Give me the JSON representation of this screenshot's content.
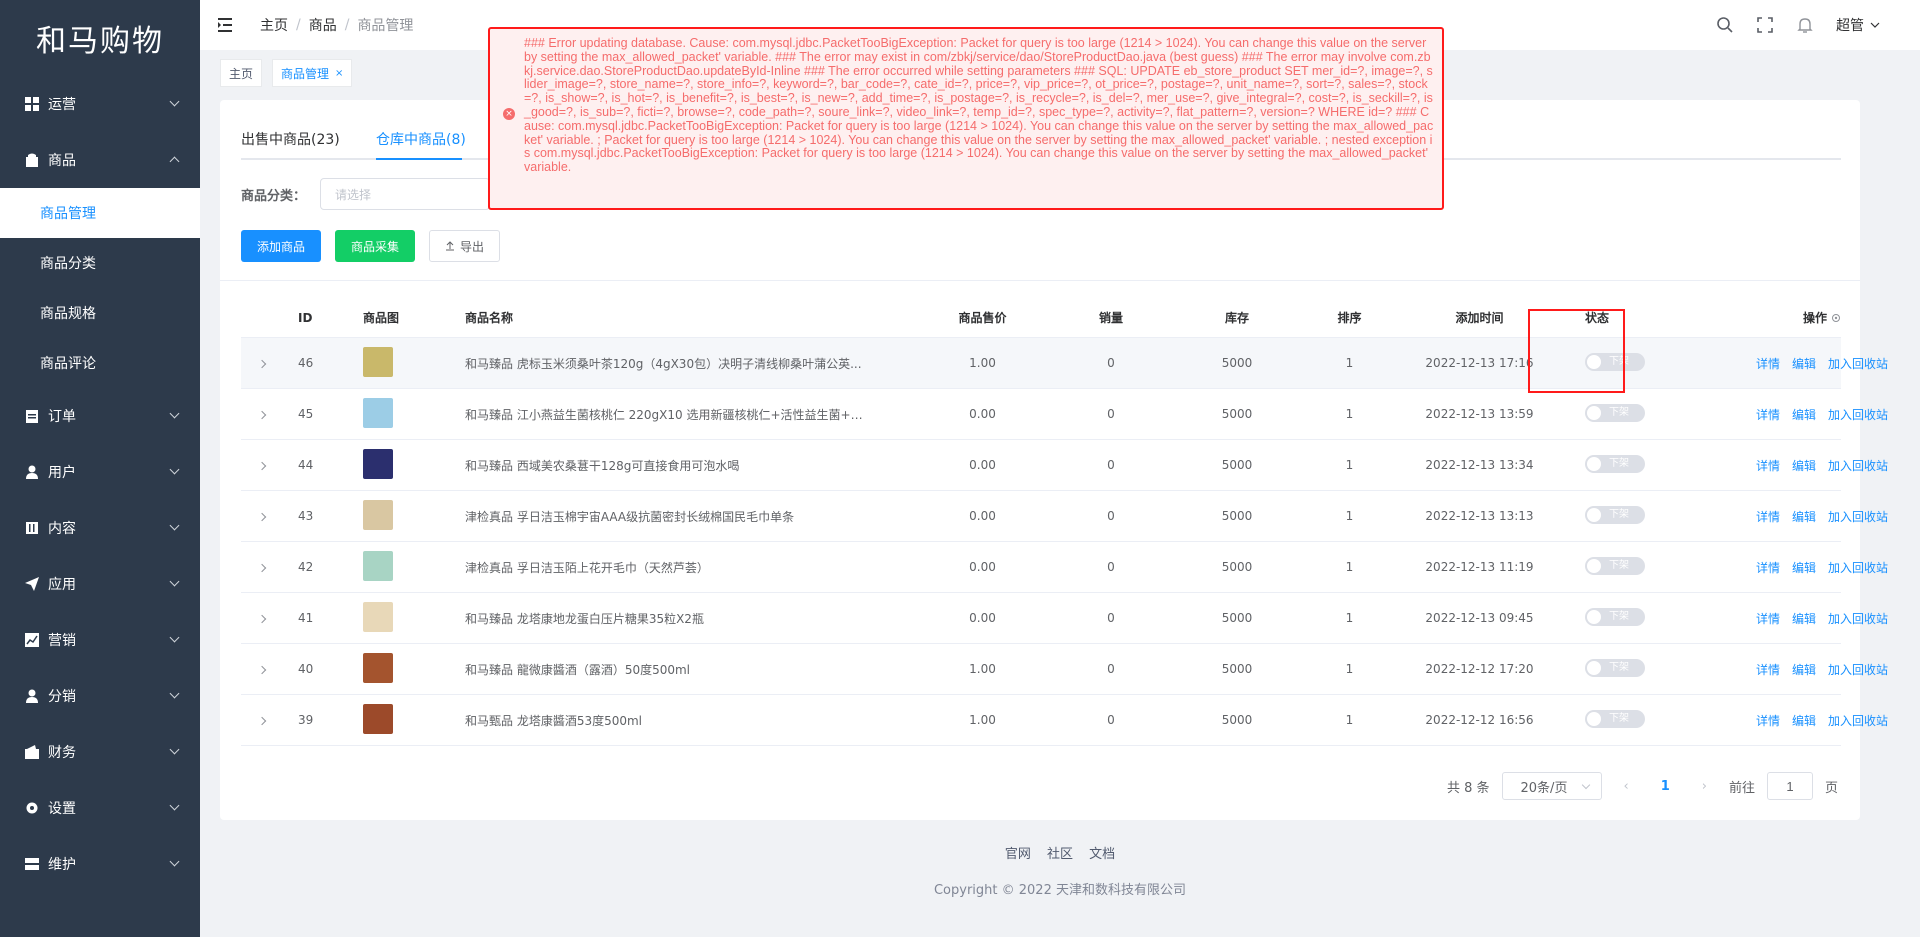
{
  "app": {
    "logo": "和马购物"
  },
  "sidebar": {
    "items": [
      {
        "label": "运营",
        "icon": "grid-icon",
        "expanded": false
      },
      {
        "label": "商品",
        "icon": "bag-icon",
        "expanded": true,
        "children": [
          "商品管理",
          "商品分类",
          "商品规格",
          "商品评论"
        ]
      },
      {
        "label": "订单",
        "icon": "clipboard-icon",
        "expanded": false
      },
      {
        "label": "用户",
        "icon": "user-icon",
        "expanded": false
      },
      {
        "label": "内容",
        "icon": "book-icon",
        "expanded": false
      },
      {
        "label": "应用",
        "icon": "send-icon",
        "expanded": false
      },
      {
        "label": "营销",
        "icon": "chart-icon",
        "expanded": false
      },
      {
        "label": "分销",
        "icon": "user-icon",
        "expanded": false
      },
      {
        "label": "财务",
        "icon": "wallet-icon",
        "expanded": false
      },
      {
        "label": "设置",
        "icon": "gear-icon",
        "expanded": false
      },
      {
        "label": "维护",
        "icon": "server-icon",
        "expanded": false
      }
    ],
    "active_child": "商品管理"
  },
  "header": {
    "breadcrumb": [
      "主页",
      "商品",
      "商品管理"
    ],
    "user": "超管"
  },
  "tags": [
    {
      "label": "主页",
      "active": false
    },
    {
      "label": "商品管理",
      "active": true,
      "close": "×"
    }
  ],
  "tabs": [
    {
      "label": "出售中商品(23)",
      "active": false
    },
    {
      "label": "仓库中商品(8)",
      "active": true
    }
  ],
  "filter": {
    "label": "商品分类：",
    "placeholder": "请选择"
  },
  "buttons": {
    "add": "添加商品",
    "collect": "商品采集",
    "export": "导出"
  },
  "table": {
    "columns": [
      "ID",
      "商品图",
      "商品名称",
      "商品售价",
      "销量",
      "库存",
      "排序",
      "添加时间",
      "状态",
      "操作"
    ],
    "rows": [
      {
        "id": "46",
        "name": "和马臻品 虎标玉米须桑叶茶120g（4gX30包）决明子清线柳桑叶蒲公英...",
        "price": "1.00",
        "sales": "0",
        "stock": "5000",
        "sort": "1",
        "time": "2022-12-13 17:16",
        "status": "下架",
        "thumb": "#c9b86a"
      },
      {
        "id": "45",
        "name": "和马臻品 江小燕益生菌核桃仁 220gX10 选用新疆核桃仁+活性益生菌+加...",
        "price": "0.00",
        "sales": "0",
        "stock": "5000",
        "sort": "1",
        "time": "2022-12-13 13:59",
        "status": "下架",
        "thumb": "#9ccde6"
      },
      {
        "id": "44",
        "name": "和马臻品 西域美农桑葚干128g可直接食用可泡水喝",
        "price": "0.00",
        "sales": "0",
        "stock": "5000",
        "sort": "1",
        "time": "2022-12-13 13:34",
        "status": "下架",
        "thumb": "#2b2f6e"
      },
      {
        "id": "43",
        "name": "津检真品 孚日洁玉棉宇宙AAA级抗菌密封长绒棉国民毛巾单条",
        "price": "0.00",
        "sales": "0",
        "stock": "5000",
        "sort": "1",
        "time": "2022-12-13 13:13",
        "status": "下架",
        "thumb": "#d9c7a2"
      },
      {
        "id": "42",
        "name": "津检真品 孚日洁玉陌上花开毛巾（天然芦荟）",
        "price": "0.00",
        "sales": "0",
        "stock": "5000",
        "sort": "1",
        "time": "2022-12-13 11:19",
        "status": "下架",
        "thumb": "#a8d4c4"
      },
      {
        "id": "41",
        "name": "和马臻品 龙塔康地龙蛋白压片糖果35粒X2瓶",
        "price": "0.00",
        "sales": "0",
        "stock": "5000",
        "sort": "1",
        "time": "2022-12-13 09:45",
        "status": "下架",
        "thumb": "#e8d8b8"
      },
      {
        "id": "40",
        "name": "和马臻品 龍微康醬酒（露酒）50度500ml",
        "price": "1.00",
        "sales": "0",
        "stock": "5000",
        "sort": "1",
        "time": "2022-12-12 17:20",
        "status": "下架",
        "thumb": "#a4542e"
      },
      {
        "id": "39",
        "name": "和马甄品 龙塔康醬酒53度500ml",
        "price": "1.00",
        "sales": "0",
        "stock": "5000",
        "sort": "1",
        "time": "2022-12-12 16:56",
        "status": "下架",
        "thumb": "#9c4a2a"
      }
    ],
    "ops": [
      "详情",
      "编辑",
      "加入回收站"
    ]
  },
  "pagination": {
    "total": "共 8 条",
    "page_size": "20条/页",
    "current": "1",
    "goto_label": "前往",
    "goto_value": "1",
    "page_suffix": "页"
  },
  "footer": {
    "links": [
      "官网",
      "社区",
      "文档"
    ],
    "copyright": "Copyright © 2022 天津和数科技有限公司"
  },
  "error": {
    "message": "### Error updating database. Cause: com.mysql.jdbc.PacketTooBigException: Packet for query is too large (1214 > 1024). You can change this value on the server by setting the max_allowed_packet' variable. ### The error may exist in com/zbkj/service/dao/StoreProductDao.java (best guess) ### The error may involve com.zbkj.service.dao.StoreProductDao.updateById-Inline ### The error occurred while setting parameters ### SQL: UPDATE eb_store_product SET mer_id=?, image=?, slider_image=?, store_name=?, store_info=?, keyword=?, bar_code=?, cate_id=?, price=?, vip_price=?, ot_price=?, postage=?, unit_name=?, sort=?, sales=?, stock=?, is_show=?, is_hot=?, is_benefit=?, is_best=?, is_new=?, add_time=?, is_postage=?, is_recycle=?, is_del=?, mer_use=?, give_integral=?, cost=?, is_seckill=?, is_good=?, is_sub=?, ficti=?, browse=?, code_path=?, soure_link=?, video_link=?, temp_id=?, spec_type=?, activity=?, flat_pattern=?, version=? WHERE id=? ### Cause: com.mysql.jdbc.PacketTooBigException: Packet for query is too large (1214 > 1024). You can change this value on the server by setting the max_allowed_packet' variable. ; Packet for query is too large (1214 > 1024). You can change this value on the server by setting the max_allowed_packet' variable. ; nested exception is com.mysql.jdbc.PacketTooBigException: Packet for query is too large (1214 > 1024). You can change this value on the server by setting the max_allowed_packet' variable."
  },
  "colors": {
    "primary": "#1890ff",
    "sidebar": "#2d3a4b",
    "error": "#f56c6c",
    "success": "#13ce66"
  }
}
